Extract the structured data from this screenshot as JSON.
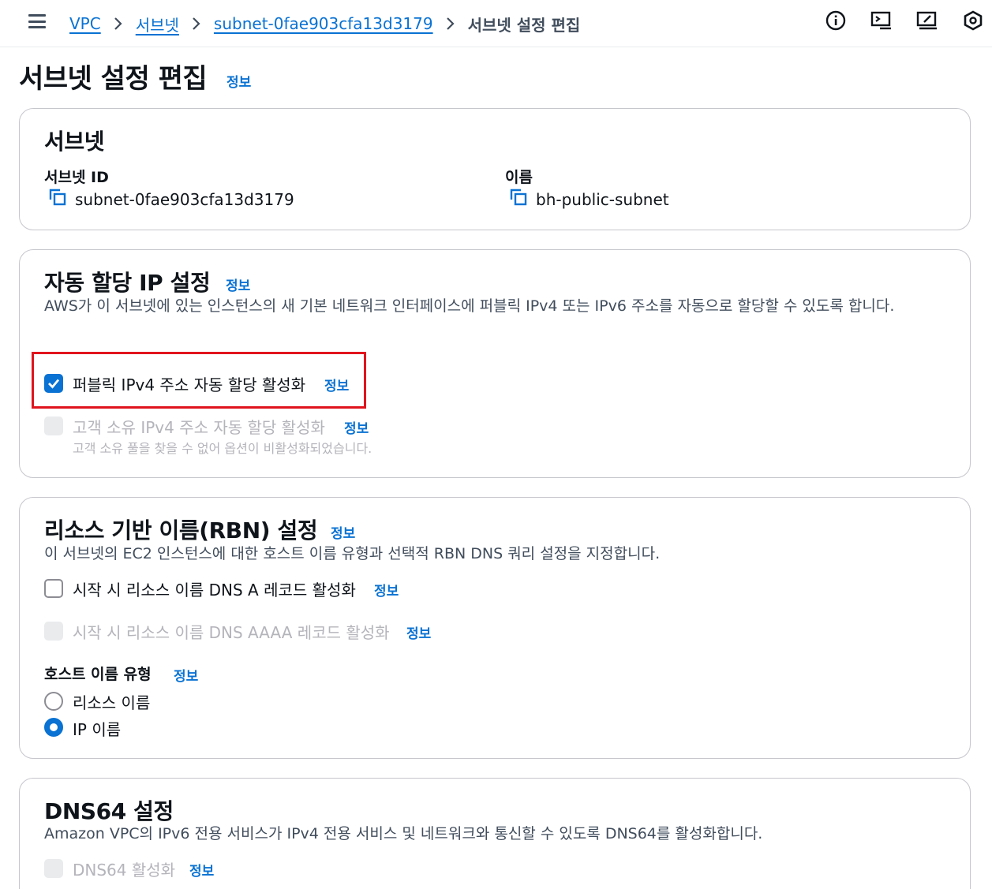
{
  "breadcrumb": {
    "items": [
      "VPC",
      "서브넷",
      "subnet-0fae903cfa13d3179"
    ],
    "current": "서브넷 설정 편집"
  },
  "top_icons": [
    "info-circle-icon",
    "cloudshell-icon",
    "screen-edit-icon",
    "hexagon-settings-icon"
  ],
  "page": {
    "title": "서브넷 설정 편집",
    "info": "정보"
  },
  "subnet": {
    "title": "서브넷",
    "id_label": "서브넷 ID",
    "id_value": "subnet-0fae903cfa13d3179",
    "name_label": "이름",
    "name_value": "bh-public-subnet"
  },
  "auto_ip": {
    "title": "자동 할당 IP 설정",
    "info": "정보",
    "desc": "AWS가 이 서브넷에 있는 인스턴스의 새 기본 네트워크 인터페이스에 퍼블릭 IPv4 또는 IPv6 주소를 자동으로 할당할 수 있도록 합니다.",
    "public_ipv4": {
      "label": "퍼블릭 IPv4 주소 자동 할당 활성화",
      "info": "정보",
      "checked": true
    },
    "customer_ipv4": {
      "label": "고객 소유 IPv4 주소 자동 할당 활성화",
      "info": "정보",
      "checked": false,
      "disabled": true,
      "note": "고객 소유 풀을 찾을 수 없어 옵션이 비활성화되었습니다."
    }
  },
  "rbn": {
    "title": "리소스 기반 이름(RBN) 설정",
    "info": "정보",
    "desc": "이 서브넷의 EC2 인스턴스에 대한 호스트 이름 유형과 선택적 RBN DNS 쿼리 설정을 지정합니다.",
    "dns_a": {
      "label": "시작 시 리소스 이름 DNS A 레코드 활성화",
      "info": "정보",
      "checked": false
    },
    "dns_aaaa": {
      "label": "시작 시 리소스 이름 DNS AAAA 레코드 활성화",
      "info": "정보",
      "checked": false,
      "disabled": true
    },
    "hostname_type": {
      "label": "호스트 이름 유형",
      "info": "정보",
      "options": [
        "리소스 이름",
        "IP 이름"
      ],
      "selected": "IP 이름"
    }
  },
  "dns64": {
    "title": "DNS64 설정",
    "desc": "Amazon VPC의 IPv6 전용 서비스가 IPv4 전용 서비스 및 네트워크와 통신할 수 있도록 DNS64를 활성화합니다.",
    "enable": {
      "label": "DNS64 활성화",
      "info": "정보",
      "checked": false,
      "disabled": true
    }
  },
  "colors": {
    "link": "#0972d3",
    "highlight": "#e0141e",
    "text": "#0f141a"
  }
}
